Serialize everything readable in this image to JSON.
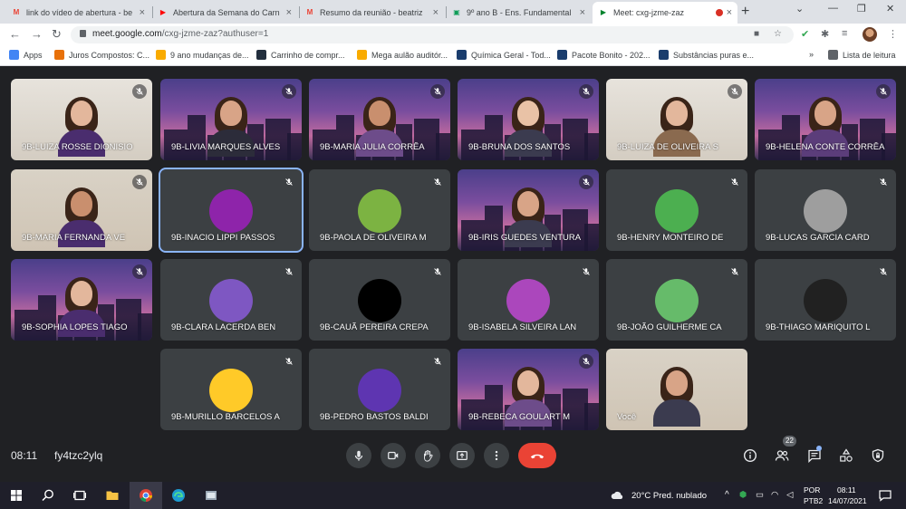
{
  "browser": {
    "tabs": [
      {
        "title": "link do vídeo de abertura - be",
        "favicon": "gmail-icon",
        "active": false
      },
      {
        "title": "Abertura da Semana do Carn",
        "favicon": "youtube-icon",
        "active": false
      },
      {
        "title": "Resumo da reunião - beatriz",
        "favicon": "gmail-icon",
        "active": false
      },
      {
        "title": "9º ano B - Ens. Fundamental",
        "favicon": "classroom-icon",
        "active": false
      },
      {
        "title": "Meet: cxg-jzme-zaz",
        "favicon": "meet-icon",
        "active": true
      }
    ],
    "url_host": "meet.google.com",
    "url_path": "/cxg-jzme-zaz?authuser=1",
    "bookmarks": [
      {
        "label": "Apps",
        "icon": "apps-grid-icon",
        "color": "#4285f4"
      },
      {
        "label": "Juros Compostos: C...",
        "icon": "bookmark-icon",
        "color": "#e8710a"
      },
      {
        "label": "9 ano mudanças de...",
        "icon": "bookmark-icon",
        "color": "#f9ab00"
      },
      {
        "label": "Carrinho de compr...",
        "icon": "amazon-icon",
        "color": "#232f3e"
      },
      {
        "label": "Mega aulão auditór...",
        "icon": "bookmark-icon",
        "color": "#f9ab00"
      },
      {
        "label": "Química Geral - Tod...",
        "icon": "bookmark-icon",
        "color": "#1a3d6d"
      },
      {
        "label": "Pacote Bonito - 202...",
        "icon": "bookmark-icon",
        "color": "#1a3d6d"
      },
      {
        "label": "Substâncias puras e...",
        "icon": "bookmark-icon",
        "color": "#1a3d6d"
      }
    ],
    "reading_list": "Lista de leitura"
  },
  "meet": {
    "participants": [
      {
        "name": "9B-LUIZA ROSSE DIONISIO",
        "kind": "video-room",
        "mic_muted": true
      },
      {
        "name": "9B-LIVIA MARQUES ALVES",
        "kind": "video-city",
        "mic_muted": true
      },
      {
        "name": "9B-MARIA JULIA CORRÊA",
        "kind": "video-city",
        "mic_muted": true
      },
      {
        "name": "9B-BRUNA DOS SANTOS",
        "kind": "video-city",
        "mic_muted": true
      },
      {
        "name": "9B-LUIZA DE OLIVEIRA S",
        "kind": "video-room",
        "mic_muted": true
      },
      {
        "name": "9B-HELENA CONTE CORRÊA",
        "kind": "video-city",
        "mic_muted": true
      },
      {
        "name": "9B-MARIA FERNANDA VE",
        "kind": "video-room2",
        "mic_muted": true
      },
      {
        "name": "9B-INACIO LIPPI PASSOS",
        "kind": "avatar",
        "avatar_color": "#8e24aa",
        "selected": true,
        "mic_muted": true
      },
      {
        "name": "9B-PAOLA DE OLIVEIRA M",
        "kind": "avatar",
        "avatar_color": "#7cb342",
        "mic_muted": true
      },
      {
        "name": "9B-IRIS GUEDES VENTURA",
        "kind": "video-city",
        "mic_muted": true
      },
      {
        "name": "9B-HENRY MONTEIRO DE",
        "kind": "avatar",
        "avatar_color": "#4caf50",
        "mic_muted": true
      },
      {
        "name": "9B-LUCAS GARCIA CARD",
        "kind": "avatar",
        "avatar_color": "#9e9e9e",
        "mic_muted": true
      },
      {
        "name": "9B-SOPHIA LOPES TIAGO",
        "kind": "video-city",
        "mic_muted": true
      },
      {
        "name": "9B-CLARA LACERDA BEN",
        "kind": "avatar",
        "avatar_color": "#7e57c2",
        "mic_muted": true
      },
      {
        "name": "9B-CAUÃ PEREIRA CREPA",
        "kind": "avatar",
        "avatar_color": "#000000",
        "mic_muted": true
      },
      {
        "name": "9B-ISABELA SILVEIRA LAN",
        "kind": "avatar",
        "avatar_color": "#ab47bc",
        "mic_muted": true
      },
      {
        "name": "9B-JOÃO GUILHERME CA",
        "kind": "avatar",
        "avatar_color": "#66bb6a",
        "mic_muted": true
      },
      {
        "name": "9B-THIAGO MARIQUITO L",
        "kind": "avatar",
        "avatar_color": "#212121",
        "mic_muted": true
      },
      {
        "name": "9B-MURILLO BARCELOS A",
        "kind": "avatar",
        "avatar_color": "#ffca28",
        "mic_muted": true
      },
      {
        "name": "9B-PEDRO BASTOS BALDI",
        "kind": "avatar",
        "avatar_color": "#5e35b1",
        "mic_muted": true
      },
      {
        "name": "9B-REBECA GOULART M",
        "kind": "video-city",
        "mic_muted": true
      },
      {
        "name": "Você",
        "kind": "video-room2",
        "mic_muted": false
      }
    ],
    "time": "08:11",
    "meeting_code": "fy4tzc2ylq",
    "participant_count": "22",
    "colors": {
      "background": "#202124",
      "tile": "#3c4043",
      "end_call": "#ea4335",
      "accent": "#8ab4f8"
    }
  },
  "taskbar": {
    "weather": "20°C  Pred. nublado",
    "lang_top": "POR",
    "lang_bottom": "PTB2",
    "clock_time": "08:11",
    "clock_date": "14/07/2021"
  }
}
